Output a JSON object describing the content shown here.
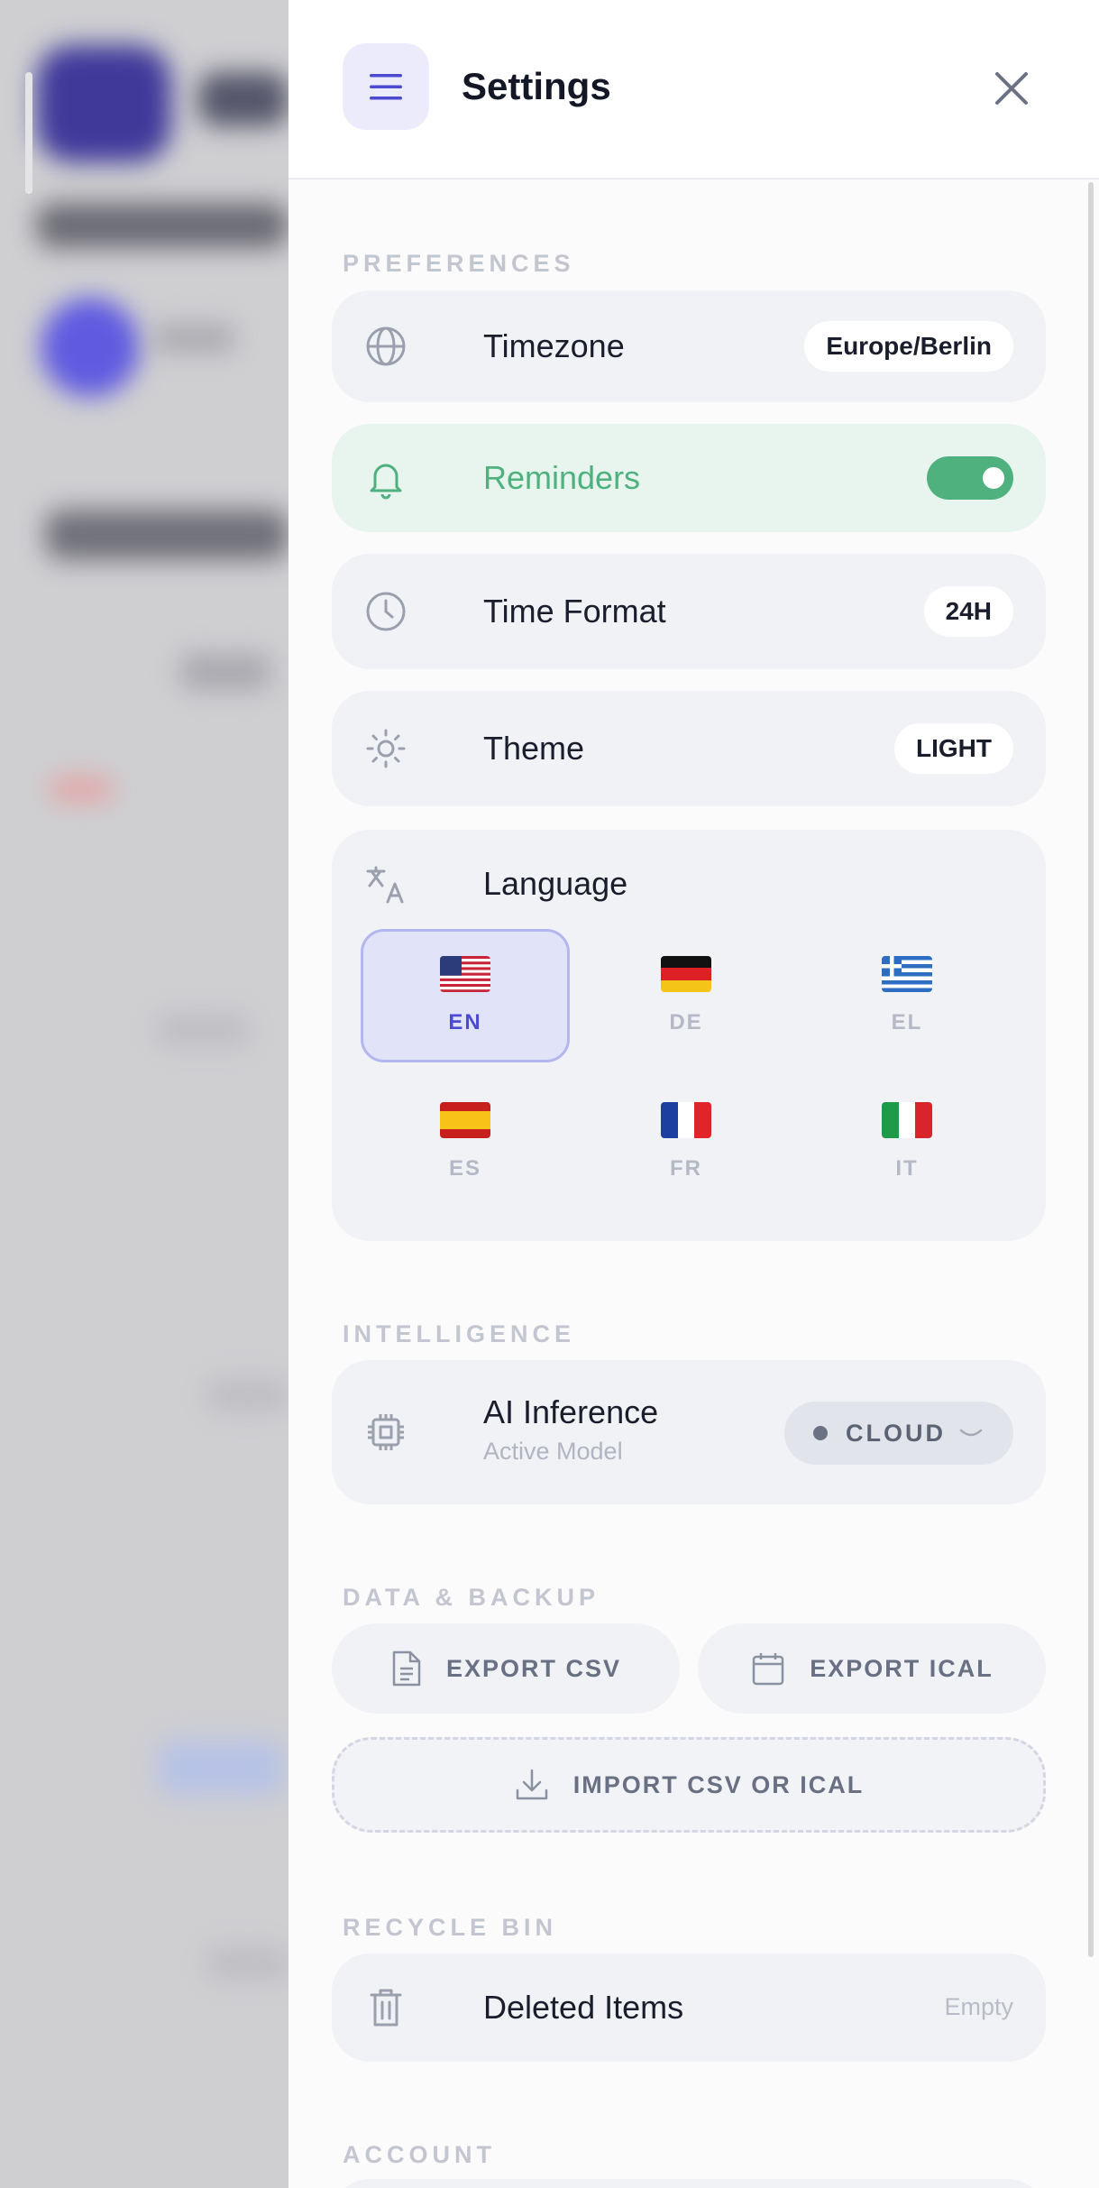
{
  "panel": {
    "title": "Settings"
  },
  "sections": {
    "preferences": "PREFERENCES",
    "intelligence": "INTELLIGENCE",
    "data_backup": "DATA & BACKUP",
    "recycle_bin": "RECYCLE BIN",
    "account": "ACCOUNT"
  },
  "preferences": {
    "timezone": {
      "label": "Timezone",
      "value": "Europe/Berlin",
      "icon": "globe-icon"
    },
    "reminders": {
      "label": "Reminders",
      "enabled": true,
      "icon": "bell-icon"
    },
    "time_format": {
      "label": "Time Format",
      "value": "24H",
      "icon": "clock-icon"
    },
    "theme": {
      "label": "Theme",
      "value": "LIGHT",
      "icon": "sun-icon"
    },
    "language": {
      "label": "Language",
      "icon": "translate-icon",
      "selected": "EN",
      "options": [
        {
          "code": "EN"
        },
        {
          "code": "DE"
        },
        {
          "code": "EL"
        },
        {
          "code": "ES"
        },
        {
          "code": "FR"
        },
        {
          "code": "IT"
        }
      ]
    }
  },
  "intelligence": {
    "label": "AI Inference",
    "sublabel": "Active Model",
    "value": "CLOUD",
    "icon": "cpu-icon"
  },
  "data_backup": {
    "export_csv": "EXPORT CSV",
    "export_ical": "EXPORT ICAL",
    "import": "IMPORT CSV OR ICAL"
  },
  "recycle_bin": {
    "label": "Deleted Items",
    "status": "Empty",
    "icon": "trash-icon"
  },
  "colors": {
    "accent": "#4b4ad1",
    "success": "#4fb17e",
    "reminders_bg": "#e8f5ef",
    "card_bg": "#f1f2f6"
  }
}
